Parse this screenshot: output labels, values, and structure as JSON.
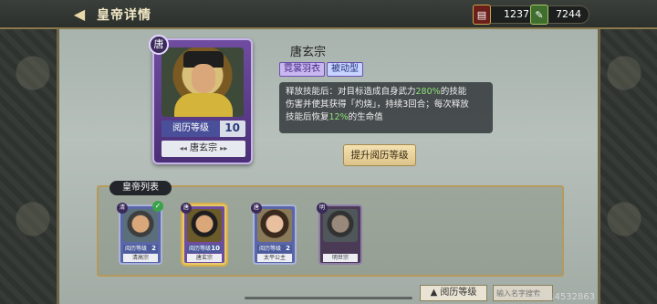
{
  "header": {
    "title": "皇帝详情",
    "back_icon": "back-arrow-icon",
    "currencies": [
      {
        "icon": "book-icon",
        "value": "1237"
      },
      {
        "icon": "scroll-icon",
        "value": "7244"
      }
    ]
  },
  "hero": {
    "name": "唐玄宗",
    "dynasty_badge": "唐",
    "level_label": "阅历等级",
    "level": "10",
    "tags": [
      "霓裳羽衣",
      "被动型"
    ],
    "skill": {
      "line1_a": "释放技能后：对目标造成自身武力",
      "line1_pct": "280%",
      "line1_b": "的技能",
      "line2": "伤害并使其获得「灼烧」，持续3回合；每次释放",
      "line3_a": "技能后恢复",
      "line3_pct": "12%",
      "line3_b": "的生命值"
    },
    "upgrade_button": "提升阅历等级"
  },
  "roster": {
    "title": "皇帝列表",
    "items": [
      {
        "badge": "清",
        "level_label": "阅历等级",
        "level": "2",
        "name": "清高宗",
        "checked": true
      },
      {
        "badge": "唐",
        "level_label": "阅历等级",
        "level": "10",
        "name": "唐玄宗",
        "selected": true
      },
      {
        "badge": "唐",
        "level_label": "阅历等级",
        "level": "2",
        "name": "太平公主"
      },
      {
        "badge": "明",
        "level_label": "",
        "level": "",
        "name": "明世宗",
        "locked": true
      }
    ]
  },
  "footer": {
    "sort_label": "▲ 阅历等级",
    "search_placeholder": "输入名字搜索",
    "uid": "ID: 14532863"
  }
}
